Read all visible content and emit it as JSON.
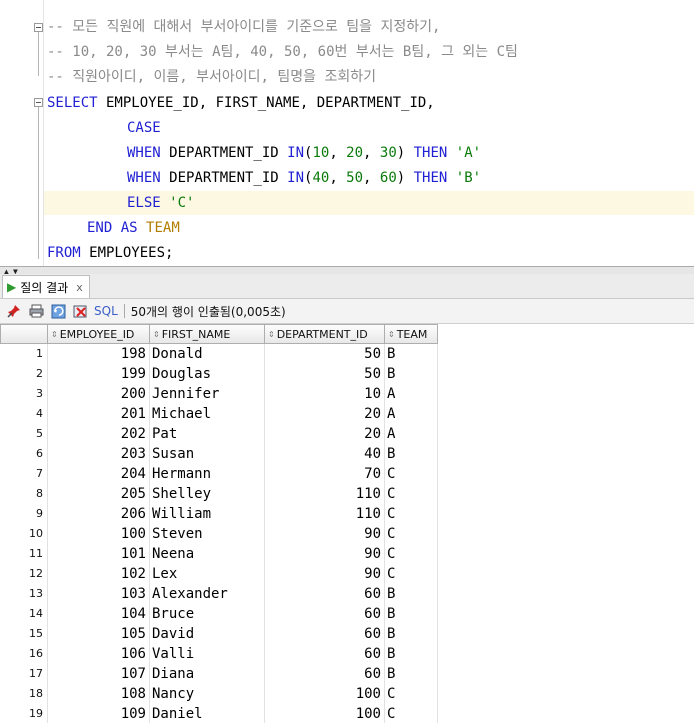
{
  "editor": {
    "comments": [
      "-- 모든 직원에 대해서 부서아이디를 기준으로 팀을 지정하기,",
      "-- 10, 20, 30 부서는 A팀, 40, 50, 60번 부서는 B팀, 그 외는 C팀",
      "-- 직원아이디, 이름, 부서아이디, 팀명을 조회하기"
    ],
    "select_kw": "SELECT",
    "select_cols": " EMPLOYEE_ID, FIRST_NAME, DEPARTMENT_ID,",
    "case_kw": "CASE",
    "when_kw": "WHEN",
    "dept_col": " DEPARTMENT_ID ",
    "in_kw": "IN",
    "when1_nums": [
      "10",
      "20",
      "30"
    ],
    "when2_nums": [
      "40",
      "50",
      "60"
    ],
    "then_kw": "THEN",
    "val_a": "'A'",
    "val_b": "'B'",
    "else_kw": "ELSE",
    "val_c": "'C'",
    "end_kw": "END",
    "as_kw": "AS",
    "alias": "TEAM",
    "from_kw": "FROM",
    "from_table": " EMPLOYEES;"
  },
  "results_tab": {
    "label": "질의 결과",
    "close": "x"
  },
  "toolbar": {
    "sql_label": "SQL",
    "status": "50개의 행이 인출됨(0,005초)"
  },
  "grid": {
    "columns": [
      "EMPLOYEE_ID",
      "FIRST_NAME",
      "DEPARTMENT_ID",
      "TEAM"
    ],
    "rows": [
      [
        "1",
        "198",
        "Donald",
        "50",
        "B"
      ],
      [
        "2",
        "199",
        "Douglas",
        "50",
        "B"
      ],
      [
        "3",
        "200",
        "Jennifer",
        "10",
        "A"
      ],
      [
        "4",
        "201",
        "Michael",
        "20",
        "A"
      ],
      [
        "5",
        "202",
        "Pat",
        "20",
        "A"
      ],
      [
        "6",
        "203",
        "Susan",
        "40",
        "B"
      ],
      [
        "7",
        "204",
        "Hermann",
        "70",
        "C"
      ],
      [
        "8",
        "205",
        "Shelley",
        "110",
        "C"
      ],
      [
        "9",
        "206",
        "William",
        "110",
        "C"
      ],
      [
        "10",
        "100",
        "Steven",
        "90",
        "C"
      ],
      [
        "11",
        "101",
        "Neena",
        "90",
        "C"
      ],
      [
        "12",
        "102",
        "Lex",
        "90",
        "C"
      ],
      [
        "13",
        "103",
        "Alexander",
        "60",
        "B"
      ],
      [
        "14",
        "104",
        "Bruce",
        "60",
        "B"
      ],
      [
        "15",
        "105",
        "David",
        "60",
        "B"
      ],
      [
        "16",
        "106",
        "Valli",
        "60",
        "B"
      ],
      [
        "17",
        "107",
        "Diana",
        "60",
        "B"
      ],
      [
        "18",
        "108",
        "Nancy",
        "100",
        "C"
      ],
      [
        "19",
        "109",
        "Daniel",
        "100",
        "C"
      ]
    ]
  },
  "icons": [
    "fold-icon",
    "play-icon",
    "pin-icon",
    "print-icon",
    "refresh-icon",
    "delete-icon",
    "sort-icon"
  ]
}
